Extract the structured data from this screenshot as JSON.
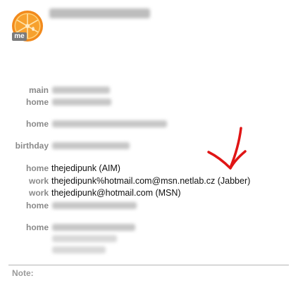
{
  "card": {
    "me_badge": "me",
    "name": ""
  },
  "fields": {
    "main_label": "main",
    "home_phone_label": "home",
    "home_email_label": "home",
    "birthday_label": "birthday",
    "home_im_label": "home",
    "work_im1_label": "work",
    "work_im2_label": "work",
    "home_address1_label": "home",
    "home_address2_label": "home",
    "home_im_value": "thejedipunk (AIM)",
    "work_im1_value": "thejedipunk%hotmail.com@msn.netlab.cz (Jabber)",
    "work_im2_value": "thejedipunk@hotmail.com (MSN)"
  },
  "footer": {
    "note_label": "Note:"
  },
  "colors": {
    "label": "#8a8a8a",
    "value": "#111111",
    "arrow": "#e01515",
    "avatar_orange": "#f28a1c"
  },
  "icons": {
    "avatar": "orange-slice-avatar",
    "annotation": "red-arrow-icon"
  }
}
